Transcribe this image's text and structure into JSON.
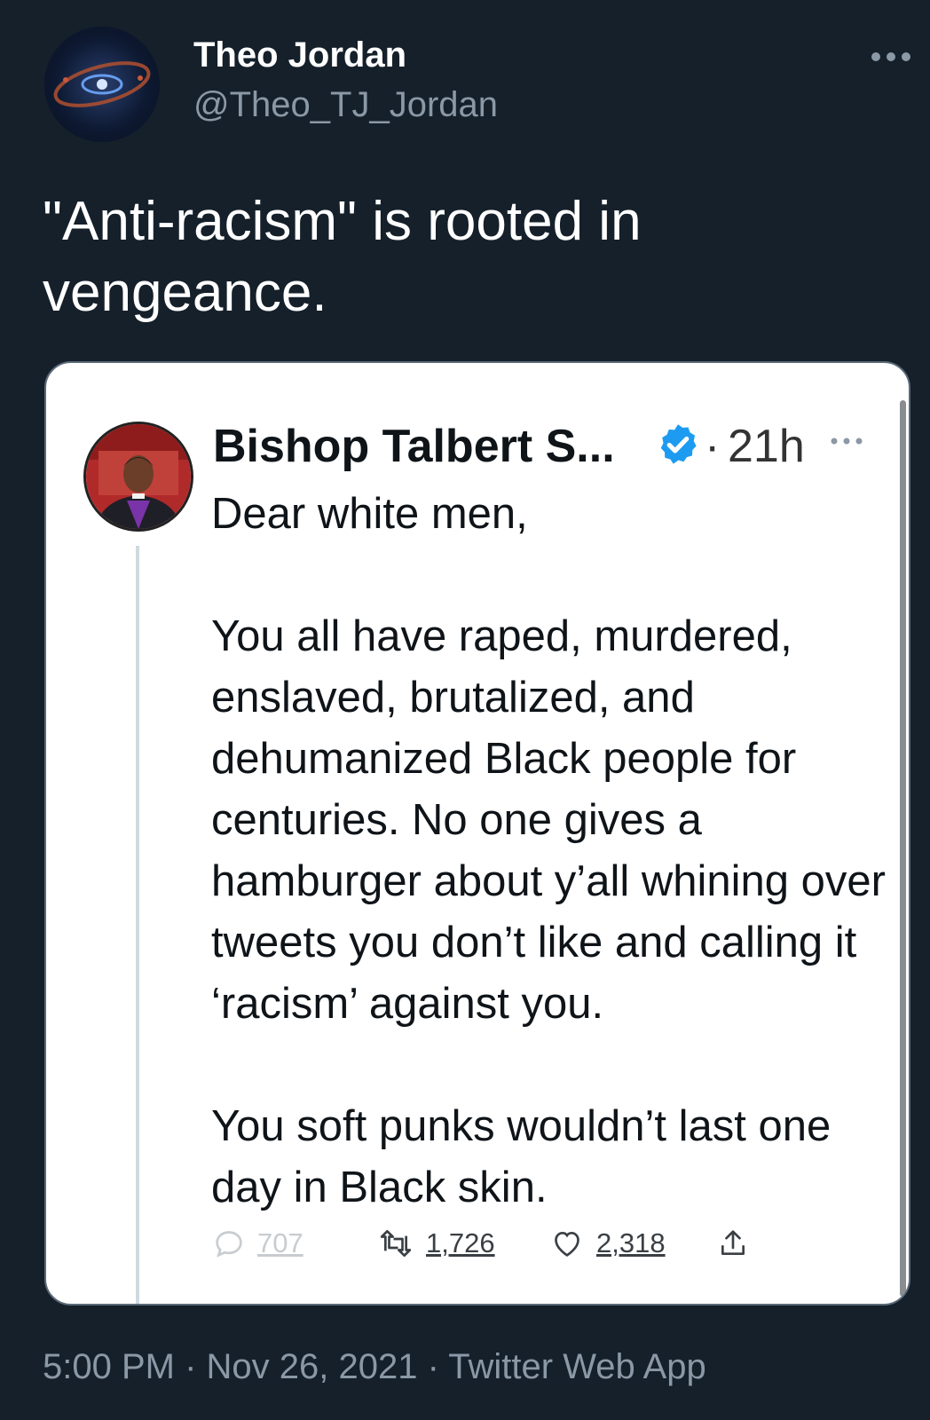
{
  "tweet": {
    "author_name": "Theo Jordan",
    "author_handle": "@Theo_TJ_Jordan",
    "avatar_icon": "galaxy-avatar",
    "text": "\"Anti-racism\" is rooted in vengeance.",
    "timestamp": "5:00 PM · Nov 26, 2021 · Twitter Web App"
  },
  "quoted_tweet": {
    "author_name": "Bishop Talbert S...",
    "verified": true,
    "dot": "·",
    "time": "21h",
    "paragraphs": [
      "Dear white men,",
      "You all have raped, murdered, enslaved, brutalized, and dehumanized Black people for centuries. No one gives a hamburger about y’all whining over tweets you don’t like and calling it ‘racism’ against you.",
      "You soft punks wouldn’t last one day in Black skin."
    ],
    "actions": {
      "replies": "707",
      "retweets": "1,726",
      "likes": "2,318"
    }
  },
  "colors": {
    "background": "#15202b",
    "secondary_text": "#8b98a5",
    "verified_blue": "#1d9bf0"
  }
}
